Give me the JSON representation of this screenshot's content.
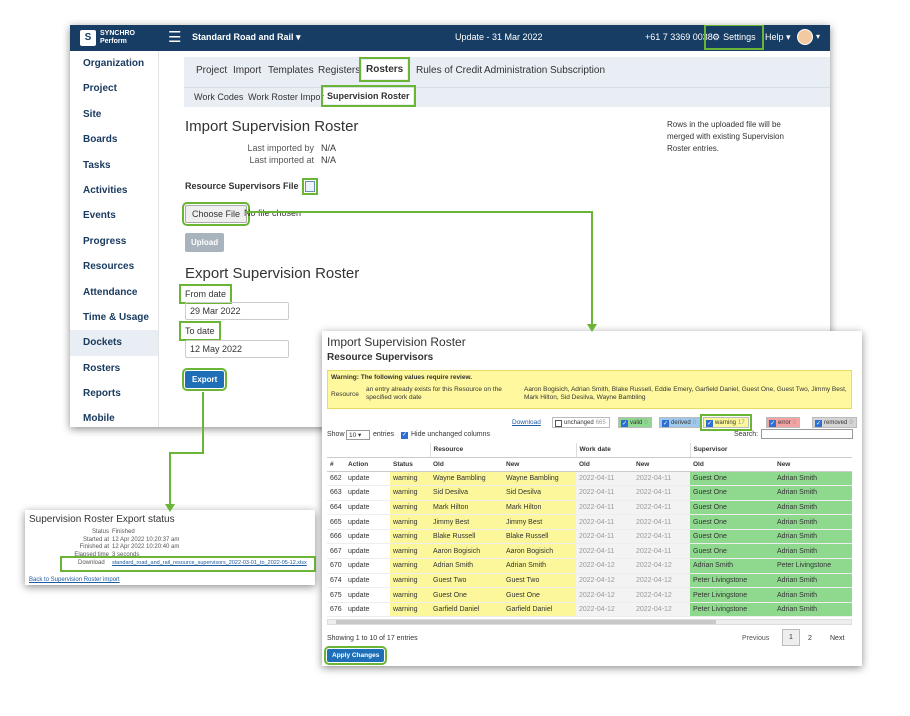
{
  "topbar": {
    "logo_line1": "SYNCHRO",
    "logo_line2": "Perform",
    "project": "Standard Road and Rail ▾",
    "update": "Update - 31 Mar 2022",
    "phone": "+61 7 3369 0038",
    "settings": "Settings",
    "help": "Help ▾"
  },
  "sidebar": [
    "Organization",
    "Project",
    "Site",
    "Boards",
    "Tasks",
    "Activities",
    "Events",
    "Progress",
    "Resources",
    "Attendance",
    "Time & Usage",
    "Dockets",
    "Rosters",
    "Reports",
    "Mobile"
  ],
  "tabs1": [
    "Project",
    "Import",
    "Templates",
    "Registers",
    "Rosters",
    "Rules of Credit",
    "Administration",
    "Subscription"
  ],
  "tabs2": [
    "Work Codes",
    "Work Roster Import",
    "Supervision Roster"
  ],
  "import": {
    "title": "Import Supervision Roster",
    "last_by_label": "Last imported by",
    "last_by_value": "N/A",
    "last_at_label": "Last imported at",
    "last_at_value": "N/A",
    "file_label": "Resource Supervisors File",
    "choose": "Choose File",
    "nofile": "No file chosen",
    "upload": "Upload",
    "note": "Rows in the uploaded file will be merged with existing Supervision Roster entries."
  },
  "export": {
    "title": "Export Supervision Roster",
    "from_label": "From date",
    "from_value": "29 Mar 2022",
    "to_label": "To date",
    "to_value": "12 May 2022",
    "button": "Export"
  },
  "status_card": {
    "title": "Supervision Roster Export status",
    "rows": [
      {
        "label": "Status",
        "value": "Finished"
      },
      {
        "label": "Started at",
        "value": "12 Apr 2022 10:20:37 am"
      },
      {
        "label": "Finished at",
        "value": "12 Apr 2022 10:20:40 am"
      },
      {
        "label": "Elapsed time",
        "value": "3 seconds"
      }
    ],
    "download_label": "Download",
    "download_file": "standard_road_and_rail_resource_supervisors_2022-03-01_to_2022-05-12.xlsx",
    "back": "Back to Supervision Roster import"
  },
  "review": {
    "title": "Import Supervision Roster",
    "subtitle": "Resource Supervisors",
    "warn_title": "Warning: The following values require review.",
    "warn_label": "Resource",
    "warn_msg": "an entry already exists for this Resource on the specified work date",
    "warn_names": "Aaron Bogisich, Adrian Smith, Blake Russell, Eddie Emery, Garfield Daniel, Guest One, Guest Two, Jimmy Best, Mark Hilton, Sid Desilva, Wayne Bambling",
    "download": "Download",
    "filters": [
      {
        "label": "unchanged",
        "count": "665",
        "on": false,
        "color": "#ffffff"
      },
      {
        "label": "valid",
        "count": "0",
        "on": true,
        "color": "#8ed98e"
      },
      {
        "label": "derived",
        "count": "0",
        "on": true,
        "color": "#9ec9ec"
      },
      {
        "label": "warning",
        "count": "17",
        "on": true,
        "color": "#fbf79a"
      },
      {
        "label": "error",
        "count": "0",
        "on": true,
        "color": "#f3a3a3"
      },
      {
        "label": "removed",
        "count": "0",
        "on": true,
        "color": "#d5d5d5"
      }
    ],
    "show": "Show",
    "page_size": "10",
    "entries": "entries",
    "hide_unchanged": "Hide unchanged columns",
    "search": "Search:",
    "head_groups": [
      "Resource",
      "Work date",
      "Supervisor"
    ],
    "head_cols": [
      "#",
      "Action",
      "Status",
      "Old",
      "New",
      "Old",
      "New",
      "Old",
      "New"
    ],
    "rows": [
      [
        "662",
        "update",
        "warning",
        "Wayne Bambling",
        "Wayne Bambling",
        "2022-04-11",
        "2022-04-11",
        "Guest One",
        "Adrian Smith"
      ],
      [
        "663",
        "update",
        "warning",
        "Sid Desilva",
        "Sid Desilva",
        "2022-04-11",
        "2022-04-11",
        "Guest One",
        "Adrian Smith"
      ],
      [
        "664",
        "update",
        "warning",
        "Mark Hilton",
        "Mark Hilton",
        "2022-04-11",
        "2022-04-11",
        "Guest One",
        "Adrian Smith"
      ],
      [
        "665",
        "update",
        "warning",
        "Jimmy Best",
        "Jimmy Best",
        "2022-04-11",
        "2022-04-11",
        "Guest One",
        "Adrian Smith"
      ],
      [
        "666",
        "update",
        "warning",
        "Blake Russell",
        "Blake Russell",
        "2022-04-11",
        "2022-04-11",
        "Guest One",
        "Adrian Smith"
      ],
      [
        "667",
        "update",
        "warning",
        "Aaron Bogisich",
        "Aaron Bogisich",
        "2022-04-11",
        "2022-04-11",
        "Guest One",
        "Adrian Smith"
      ],
      [
        "670",
        "update",
        "warning",
        "Adrian Smith",
        "Adrian Smith",
        "2022-04-12",
        "2022-04-12",
        "Adrian Smith",
        "Peter Livingstone"
      ],
      [
        "674",
        "update",
        "warning",
        "Guest Two",
        "Guest Two",
        "2022-04-12",
        "2022-04-12",
        "Peter Livingstone",
        "Adrian Smith"
      ],
      [
        "675",
        "update",
        "warning",
        "Guest One",
        "Guest One",
        "2022-04-12",
        "2022-04-12",
        "Peter Livingstone",
        "Adrian Smith"
      ],
      [
        "676",
        "update",
        "warning",
        "Garfield Daniel",
        "Garfield Daniel",
        "2022-04-12",
        "2022-04-12",
        "Peter Livingstone",
        "Adrian Smith"
      ]
    ],
    "showing": "Showing 1 to 10 of 17 entries",
    "previous": "Previous",
    "page1": "1",
    "page2": "2",
    "next": "Next",
    "apply": "Apply Changes"
  }
}
